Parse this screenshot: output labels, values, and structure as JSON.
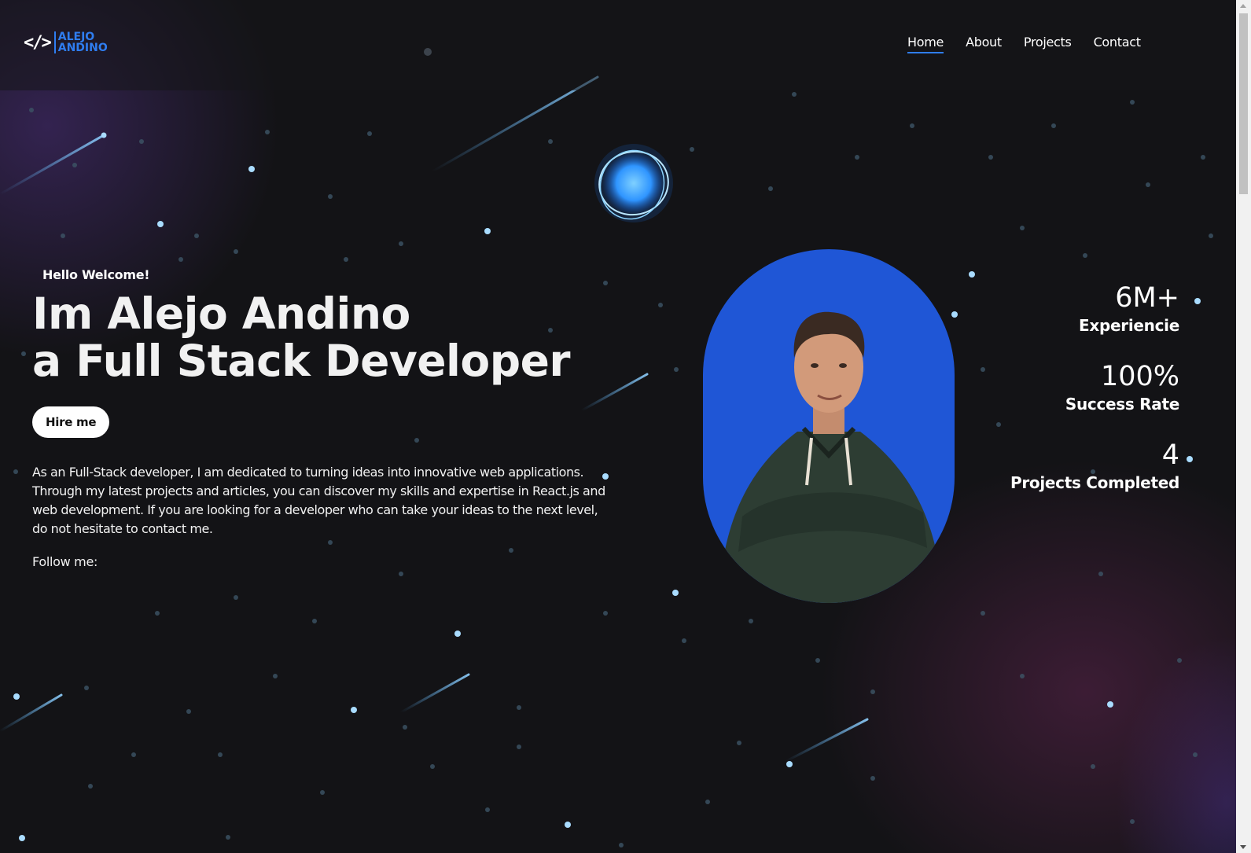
{
  "navbar": {
    "logo": {
      "icon": "</>",
      "line1": "ALEJO",
      "line2": "ANDINO",
      "color": "#2f7df0"
    },
    "links": [
      {
        "label": "Home",
        "active": true
      },
      {
        "label": "About",
        "active": false
      },
      {
        "label": "Projects",
        "active": false
      },
      {
        "label": "Contact",
        "active": false
      }
    ]
  },
  "hero": {
    "greeting": "Hello Welcome!",
    "headline_line1": "Im Alejo Andino",
    "headline_line2": "a Full Stack Developer",
    "cta_label": "Hire me",
    "intro": "As an Full-Stack developer, I am dedicated to turning ideas into innovative web applications. Through my latest projects and articles, you can discover my skills and expertise in React.js and web development. If you are looking for a developer who can take your ideas to the next level, do not hesitate to contact me.",
    "follow_label": "Follow me:"
  },
  "portrait": {
    "icon": "person-portrait",
    "background": "#1f56d6"
  },
  "planet": {
    "icon": "glowing-planet-icon",
    "color": "#3ea8ff"
  },
  "stats": [
    {
      "value": "6M+",
      "label": "Experiencie"
    },
    {
      "value": "100%",
      "label": "Success Rate"
    },
    {
      "value": "4",
      "label": "Projects Completed"
    }
  ],
  "theme": {
    "background": "#131316",
    "accent": "#2f7df0",
    "star_color": "#9fd8ff"
  }
}
